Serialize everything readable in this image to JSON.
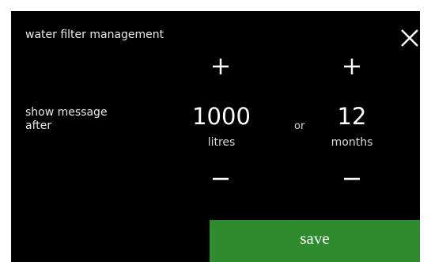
{
  "header": {
    "title": "water filter management"
  },
  "icons": {
    "close": "close-icon",
    "increase": "plus-icon",
    "decrease": "minus-icon"
  },
  "setting": {
    "label_line1": "show message",
    "label_line2": "after",
    "separator": "or",
    "litres": {
      "value": "1000",
      "unit": "litres"
    },
    "months": {
      "value": "12",
      "unit": "months"
    }
  },
  "actions": {
    "save_label": "save"
  },
  "colors": {
    "background": "#000000",
    "text": "#ffffff",
    "save_button": "#2e8b2e"
  }
}
